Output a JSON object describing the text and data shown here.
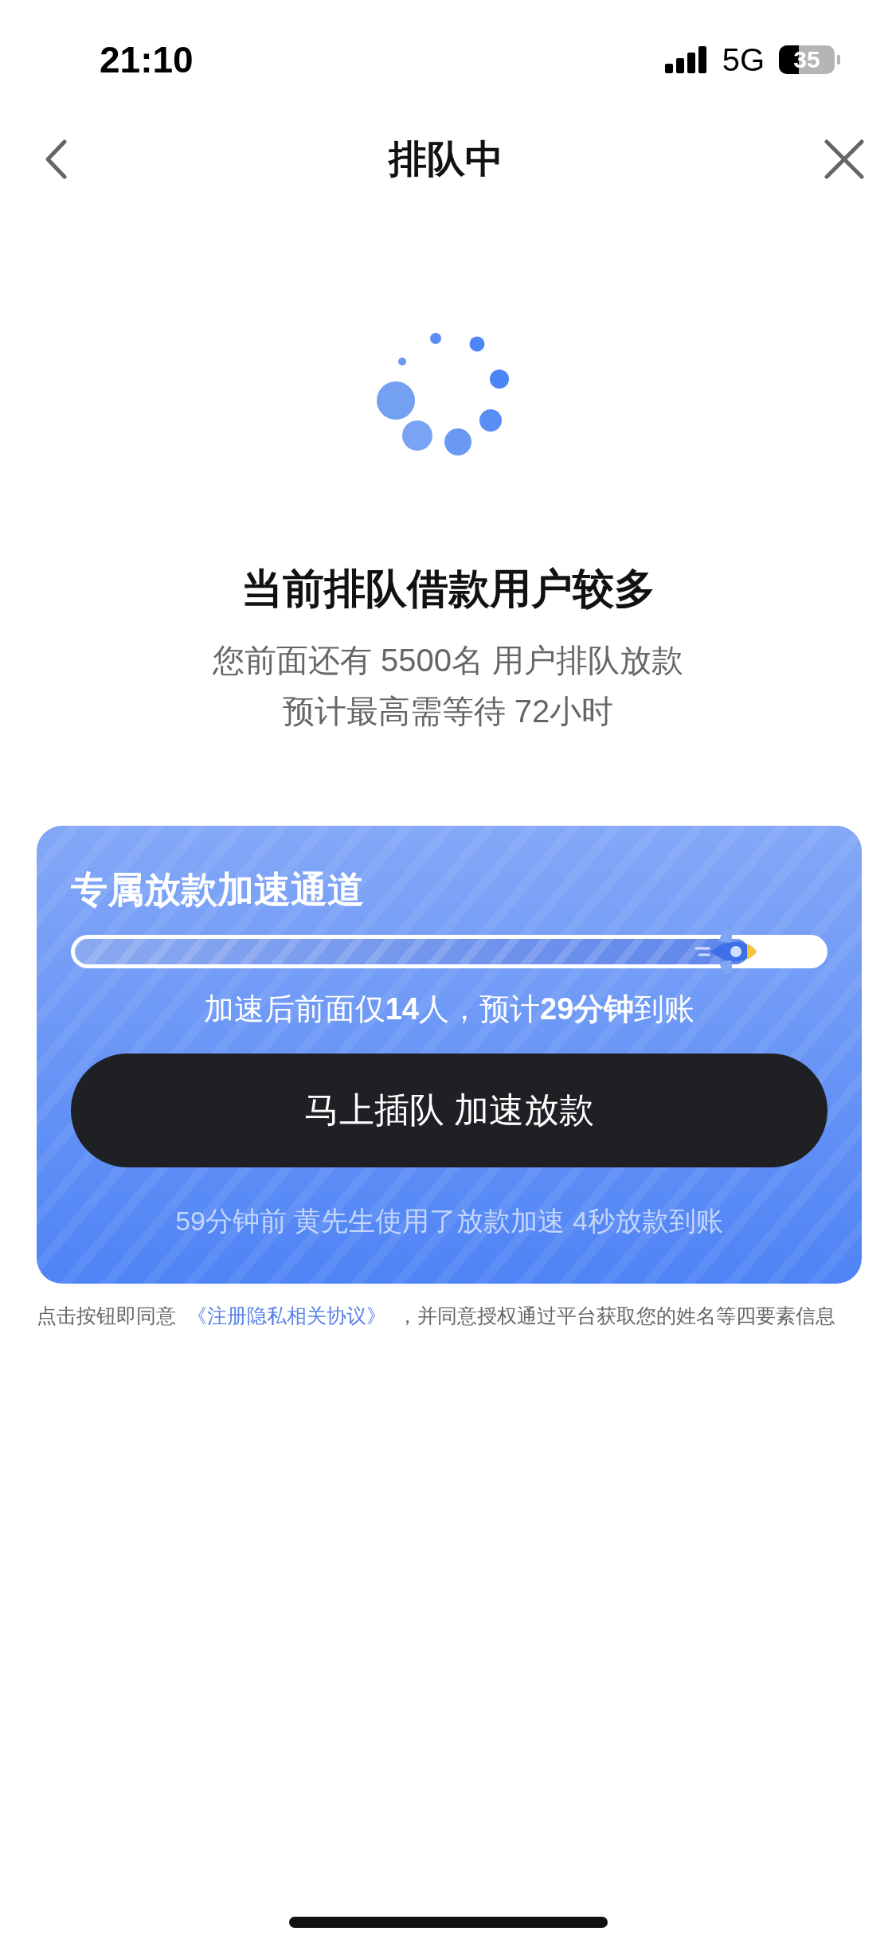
{
  "status_bar": {
    "time": "21:10",
    "network": "5G",
    "battery": "35"
  },
  "nav": {
    "title": "排队中"
  },
  "queue": {
    "heading": "当前排队借款用户较多",
    "lines": [
      "您前面还有 5500名 用户排队放款",
      "预计最高需等待 72小时"
    ]
  },
  "boost_card": {
    "title": "专属放款加速通道",
    "progress": {
      "level": 0.9
    },
    "summary": "加速后前面仅**14**人，预计**29分钟**到账",
    "button": "马上插队 加速放款",
    "note": "59分钟前 黄先生使用了放款加速 4秒放款到账"
  },
  "agreement": {
    "prefix": "点击按钮即同意",
    "link": "《注册隐私相关协议》",
    "suffix": "，并同意授权通过平台获取您的姓名等四要素信息"
  }
}
